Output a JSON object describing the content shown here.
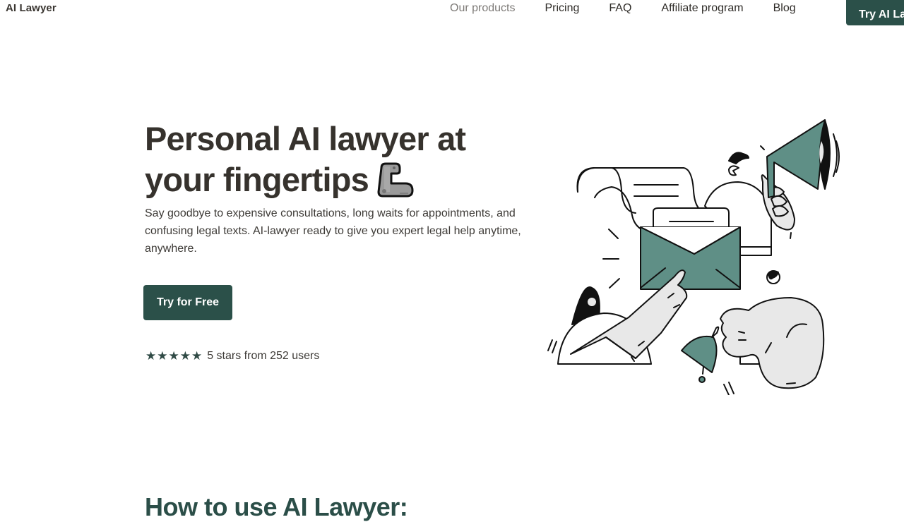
{
  "header": {
    "brand": "AI Lawyer",
    "nav": [
      {
        "label": "Our products",
        "muted": true
      },
      {
        "label": "Pricing"
      },
      {
        "label": "FAQ"
      },
      {
        "label": "Affiliate program"
      },
      {
        "label": "Blog"
      }
    ],
    "cta_label": "Try AI Lawyer"
  },
  "hero": {
    "title_line1": "Personal AI lawyer at",
    "title_line2": "your fingertips",
    "emoji": "flexed-biceps-icon",
    "description": "Say goodbye to expensive consultations, long waits for appointments, and confusing legal texts. AI-lawyer ready to give you expert legal help anytime, anywhere.",
    "cta_label": "Try for Free",
    "rating": {
      "stars": "★★★★★",
      "star_count": 5,
      "text": "5 stars from 252 users"
    }
  },
  "next_section": {
    "title": "How to use AI Lawyer:"
  },
  "colors": {
    "brand_dark": "#2b5049",
    "illustration_teal": "#5f8f86",
    "illustration_gray": "#e8e8e8",
    "text_dark": "#36322d"
  }
}
